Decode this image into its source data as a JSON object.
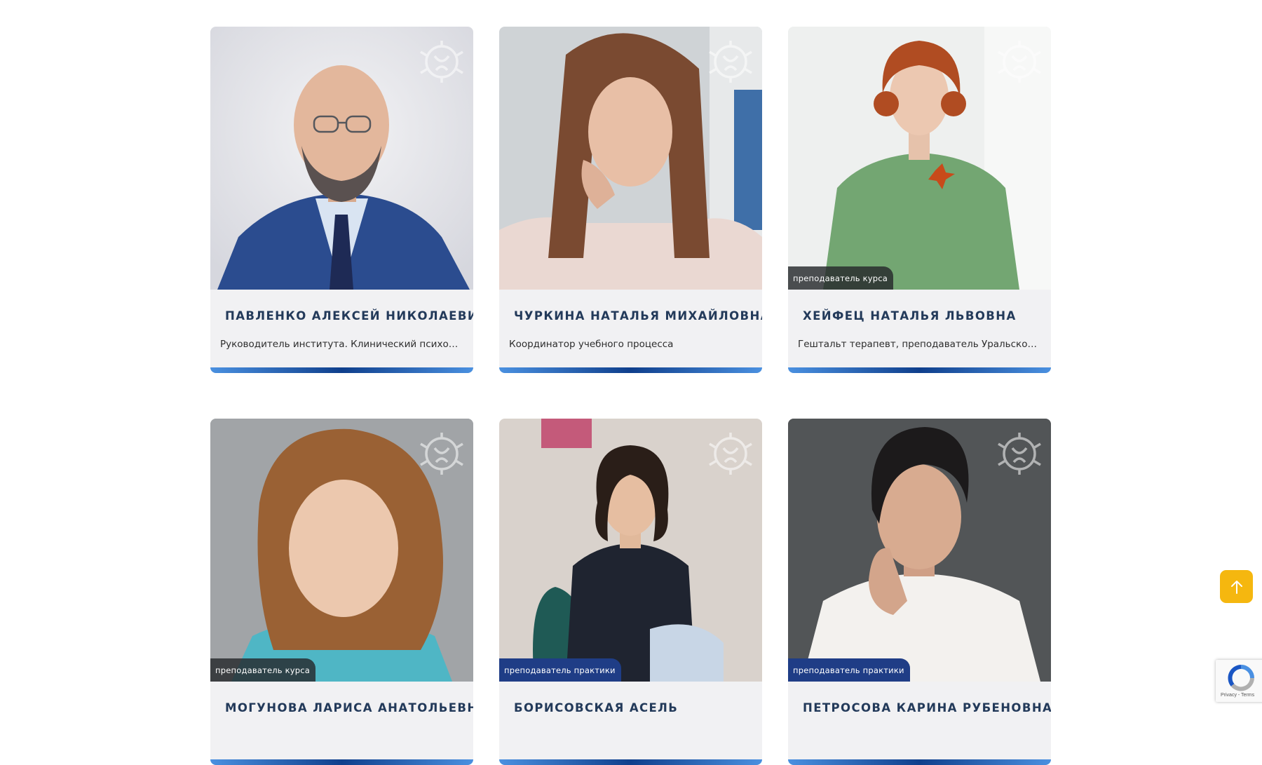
{
  "people": [
    {
      "name": "ПАВЛЕНКО АЛЕКСЕЙ НИКОЛАЕВИЧ",
      "role": "Руководитель института. Клинический психолог, психотерапевт",
      "badge": ""
    },
    {
      "name": "ЧУРКИНА НАТАЛЬЯ МИХАЙЛОВНА",
      "role": "Координатор учебного процесса",
      "badge": ""
    },
    {
      "name": "ХЕЙФЕЦ НАТАЛЬЯ ЛЬВОВНА",
      "role": "Гештальт терапевт, преподаватель Уральского института",
      "badge": "преподаватель курса"
    },
    {
      "name": "МОГУНОВА ЛАРИСА АНАТОЛЬЕВНА",
      "role": "",
      "badge": "преподаватель курса"
    },
    {
      "name": "БОРИСОВСКАЯ АСЕЛЬ",
      "role": "",
      "badge": "преподаватель практики"
    },
    {
      "name": "ПЕТРОСОВА КАРИНА РУБЕНОВНА",
      "role": "",
      "badge": "преподаватель практики"
    }
  ],
  "icons": {
    "scroll_top": "arrow-up-icon",
    "logo": "puzzle-heart-logo-icon",
    "recaptcha": "recaptcha-icon"
  },
  "recaptcha": {
    "terms": "Privacy - Terms"
  },
  "colors": {
    "card_bg": "#f1f1f3",
    "name_color": "#233a5a",
    "accent_blue": "#0f3f8c",
    "badge_blue": "#1f3d86",
    "scroll_button": "#f5b70f"
  }
}
